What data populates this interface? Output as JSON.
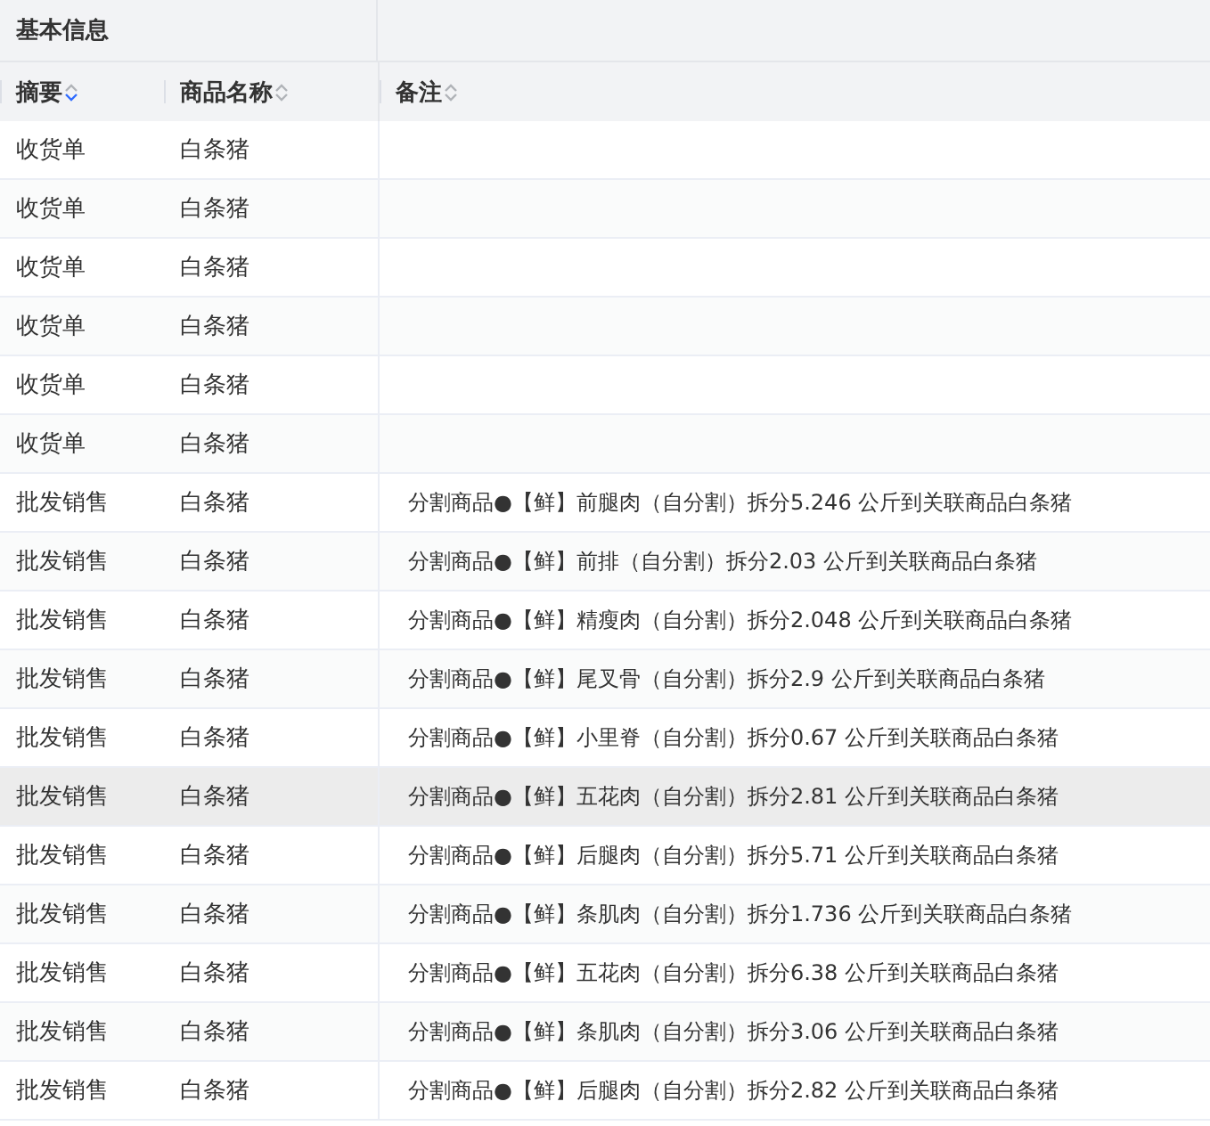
{
  "group_header": {
    "label": "基本信息"
  },
  "columns": [
    {
      "label": "摘要",
      "sorted_desc": true
    },
    {
      "label": "商品名称",
      "sorted_desc": false
    },
    {
      "label": "备注",
      "sorted_desc": false
    }
  ],
  "rows": [
    {
      "summary": "收货单",
      "product": "白条猪",
      "note": "",
      "selected": false
    },
    {
      "summary": "收货单",
      "product": "白条猪",
      "note": "",
      "selected": false
    },
    {
      "summary": "收货单",
      "product": "白条猪",
      "note": "",
      "selected": false
    },
    {
      "summary": "收货单",
      "product": "白条猪",
      "note": "",
      "selected": false
    },
    {
      "summary": "收货单",
      "product": "白条猪",
      "note": "",
      "selected": false
    },
    {
      "summary": "收货单",
      "product": "白条猪",
      "note": "",
      "selected": false
    },
    {
      "summary": "批发销售",
      "product": "白条猪",
      "note": "分割商品●【鲜】前腿肉（自分割）拆分5.246 公斤到关联商品白条猪",
      "selected": false
    },
    {
      "summary": "批发销售",
      "product": "白条猪",
      "note": "分割商品●【鲜】前排（自分割）拆分2.03 公斤到关联商品白条猪",
      "selected": false
    },
    {
      "summary": "批发销售",
      "product": "白条猪",
      "note": "分割商品●【鲜】精瘦肉（自分割）拆分2.048 公斤到关联商品白条猪",
      "selected": false
    },
    {
      "summary": "批发销售",
      "product": "白条猪",
      "note": "分割商品●【鲜】尾叉骨（自分割）拆分2.9 公斤到关联商品白条猪",
      "selected": false
    },
    {
      "summary": "批发销售",
      "product": "白条猪",
      "note": "分割商品●【鲜】小里脊（自分割）拆分0.67 公斤到关联商品白条猪",
      "selected": false
    },
    {
      "summary": "批发销售",
      "product": "白条猪",
      "note": "分割商品●【鲜】五花肉（自分割）拆分2.81 公斤到关联商品白条猪",
      "selected": true
    },
    {
      "summary": "批发销售",
      "product": "白条猪",
      "note": "分割商品●【鲜】后腿肉（自分割）拆分5.71 公斤到关联商品白条猪",
      "selected": false
    },
    {
      "summary": "批发销售",
      "product": "白条猪",
      "note": "分割商品●【鲜】条肌肉（自分割）拆分1.736 公斤到关联商品白条猪",
      "selected": false
    },
    {
      "summary": "批发销售",
      "product": "白条猪",
      "note": "分割商品●【鲜】五花肉（自分割）拆分6.38 公斤到关联商品白条猪",
      "selected": false
    },
    {
      "summary": "批发销售",
      "product": "白条猪",
      "note": "分割商品●【鲜】条肌肉（自分割）拆分3.06 公斤到关联商品白条猪",
      "selected": false
    },
    {
      "summary": "批发销售",
      "product": "白条猪",
      "note": "分割商品●【鲜】后腿肉（自分割）拆分2.82 公斤到关联商品白条猪",
      "selected": false
    }
  ]
}
